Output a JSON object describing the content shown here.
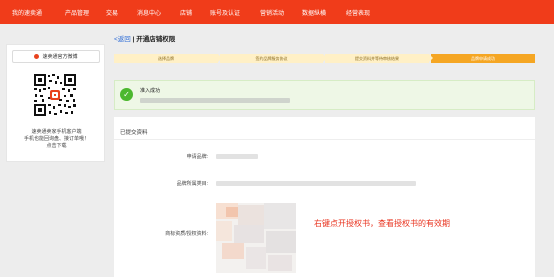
{
  "topnav": {
    "items": [
      "我的速卖通",
      "产品管理",
      "交易",
      "消息中心",
      "店铺",
      "账号及认证",
      "营销活动",
      "数据纵横",
      "经营表现"
    ]
  },
  "sidebar": {
    "official_button": "速卖通官方微博",
    "qr_caption": [
      "速卖通卖家手机客户端",
      "手机也能回询盘、接订单哦！",
      "点击下载"
    ]
  },
  "breadcrumb": {
    "back": "<返回",
    "separator": "|",
    "title": "开通店铺权限"
  },
  "steps": [
    {
      "label": "选择品牌",
      "active": false
    },
    {
      "label": "签约品牌服务协议",
      "active": false
    },
    {
      "label": "提交资料并等待审核结果",
      "active": false
    },
    {
      "label": "品牌申请成功",
      "active": true
    }
  ],
  "success": {
    "title": "准入成功"
  },
  "submitted": {
    "section_title": "已提交资料",
    "fields": [
      {
        "label": "申请品牌:"
      },
      {
        "label": "品牌所属类目:"
      },
      {
        "label": "商标资质/授权资料:"
      }
    ]
  },
  "annotation": "右键点开授权书，查看授权书的有效期",
  "colors": {
    "nav": "#f03c1a",
    "step_active": "#f5a623",
    "step_inactive": "#fff0c6",
    "success": "#4cb82f",
    "annotation": "#e8321e"
  }
}
